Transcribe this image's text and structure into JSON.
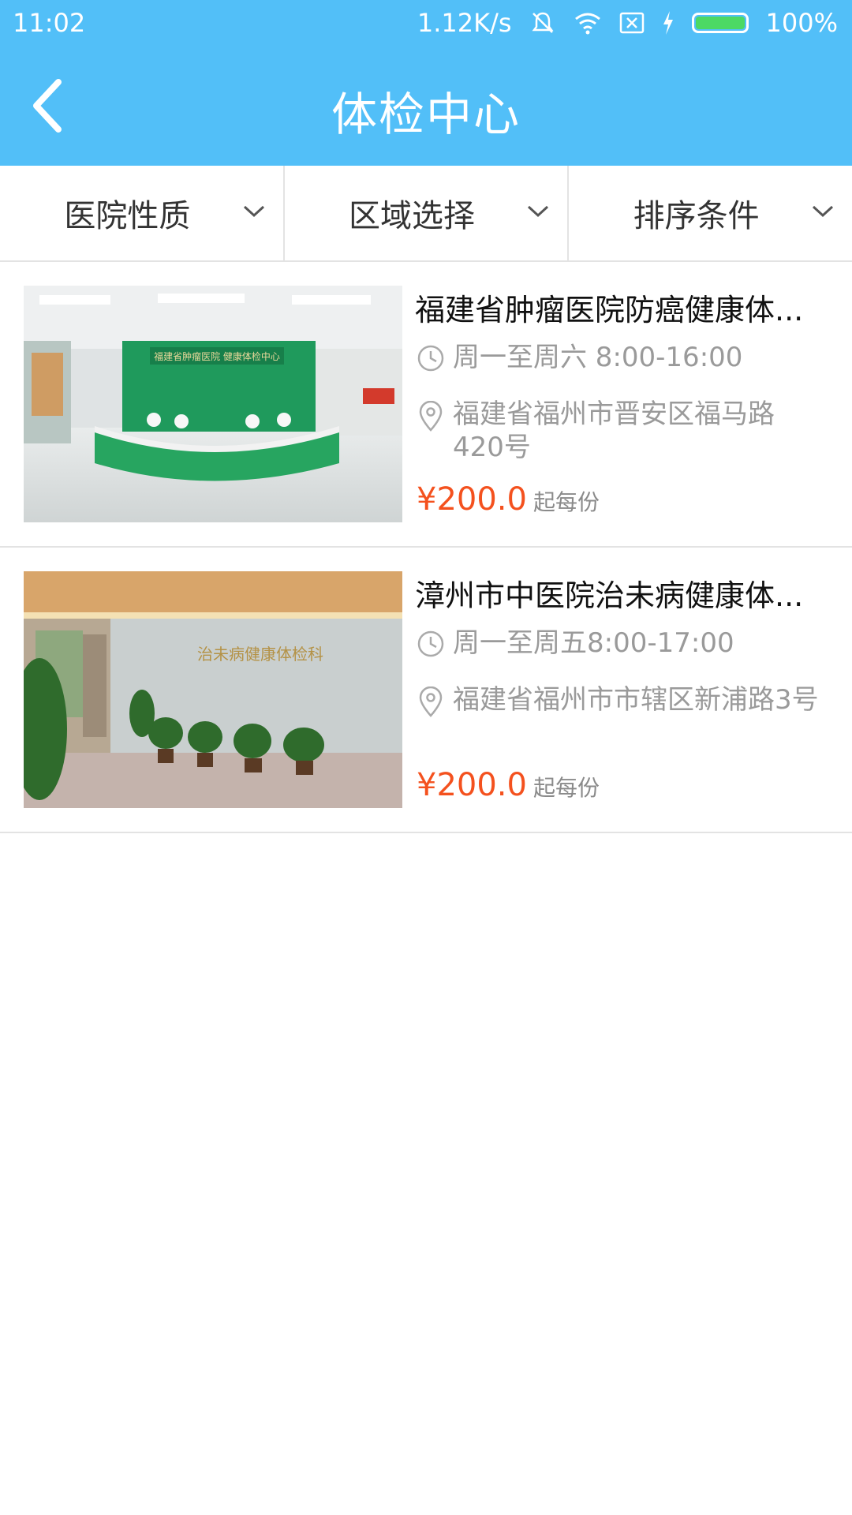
{
  "status_bar": {
    "time": "11:02",
    "network_speed": "1.12K/s",
    "battery": "100%"
  },
  "header": {
    "title": "体检中心"
  },
  "filters": [
    {
      "label": "医院性质"
    },
    {
      "label": "区域选择"
    },
    {
      "label": "排序条件"
    }
  ],
  "centers": [
    {
      "name": "福建省肿瘤医院防癌健康体...",
      "hours": "周一至周六 8:00-16:00",
      "address": "福建省福州市晋安区福马路420号",
      "price": "¥200.0",
      "price_unit": "起每份",
      "image_sign": "福建省肿瘤医院 健康体检中心"
    },
    {
      "name": "漳州市中医院治未病健康体...",
      "hours": "周一至周五8:00-17:00",
      "address": "福建省福州市市辖区新浦路3号",
      "price": "¥200.0",
      "price_unit": "起每份",
      "image_sign": "治未病健康体检科"
    }
  ],
  "colors": {
    "primary": "#52bff8",
    "price": "#f4511e",
    "secondary_text": "#9a9a9a",
    "divider": "#e3e3e3"
  },
  "icons": [
    "back-arrow-icon",
    "chevron-down-icon",
    "clock-icon",
    "location-pin-icon",
    "wifi-icon",
    "battery-icon",
    "mute-icon"
  ]
}
